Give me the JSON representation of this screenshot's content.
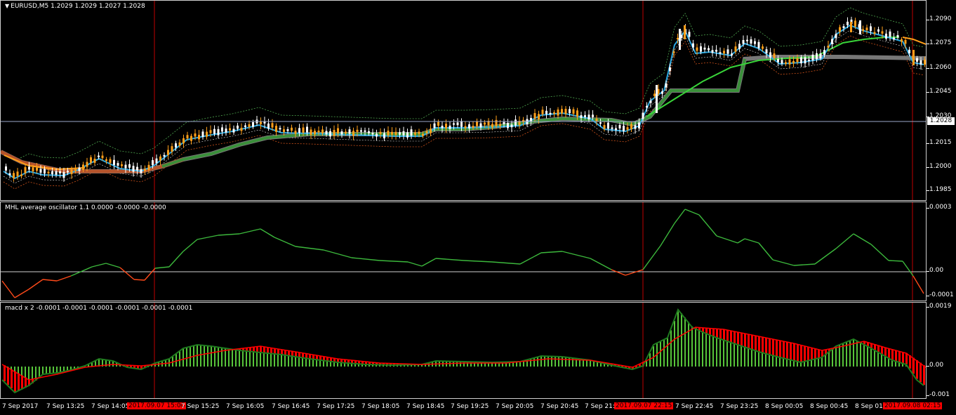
{
  "main_title": "EURUSD,M5  1.2029 1.2029 1.2027 1.2028",
  "main_scale": [
    "1.2090",
    "1.2075",
    "1.2060",
    "1.2045",
    "1.2030",
    "1.2015",
    "1.2000",
    "1.1985"
  ],
  "current_price": "1.2028",
  "osc_title": "MHL average oscillator 1.1 0.0000 -0.0000 -0.0000",
  "osc_scale": [
    "0.0003",
    "0.00",
    "-0.0001"
  ],
  "macd_title": "macd x 2 -0.0001 -0.0001 -0.0001 -0.0001 -0.0001 -0.0001",
  "macd_scale": [
    "0.0019",
    "0.00",
    "-0.001"
  ],
  "time_labels": [
    "7 Sep 2017",
    "7 Sep 13:25",
    "7 Sep 14:05",
    "7 Sep 15:25",
    "7 Sep 16:05",
    "7 Sep 16:45",
    "7 Sep 17:25",
    "7 Sep 18:05",
    "7 Sep 18:45",
    "7 Sep 19:25",
    "7 Sep 20:05",
    "7 Sep 20:45",
    "7 Sep 21:2",
    "7 Sep 22:45",
    "7 Sep 23:25",
    "8 Sep 00:05",
    "8 Sep 00:45",
    "8 Sep 01:"
  ],
  "time_highlights": [
    "2017.09.07 15:00",
    "2017.09.07 22:15",
    "2017.09.08 02:15"
  ],
  "colors": {
    "up": "#ffffff",
    "down": "#ff9f1a",
    "osc_up": "#3cb83c",
    "osc_down": "#ff4a1a",
    "macd_bar": "#57c43a",
    "macd_signal": "#ff0000",
    "vline": "#c00000"
  }
}
